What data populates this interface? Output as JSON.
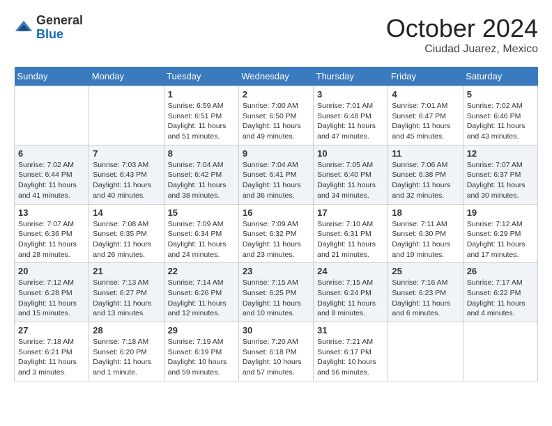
{
  "header": {
    "logo_general": "General",
    "logo_blue": "Blue",
    "month": "October 2024",
    "location": "Ciudad Juarez, Mexico"
  },
  "weekdays": [
    "Sunday",
    "Monday",
    "Tuesday",
    "Wednesday",
    "Thursday",
    "Friday",
    "Saturday"
  ],
  "weeks": [
    [
      {
        "day": "",
        "info": ""
      },
      {
        "day": "",
        "info": ""
      },
      {
        "day": "1",
        "info": "Sunrise: 6:59 AM\nSunset: 6:51 PM\nDaylight: 11 hours and 51 minutes."
      },
      {
        "day": "2",
        "info": "Sunrise: 7:00 AM\nSunset: 6:50 PM\nDaylight: 11 hours and 49 minutes."
      },
      {
        "day": "3",
        "info": "Sunrise: 7:01 AM\nSunset: 6:48 PM\nDaylight: 11 hours and 47 minutes."
      },
      {
        "day": "4",
        "info": "Sunrise: 7:01 AM\nSunset: 6:47 PM\nDaylight: 11 hours and 45 minutes."
      },
      {
        "day": "5",
        "info": "Sunrise: 7:02 AM\nSunset: 6:46 PM\nDaylight: 11 hours and 43 minutes."
      }
    ],
    [
      {
        "day": "6",
        "info": "Sunrise: 7:02 AM\nSunset: 6:44 PM\nDaylight: 11 hours and 41 minutes."
      },
      {
        "day": "7",
        "info": "Sunrise: 7:03 AM\nSunset: 6:43 PM\nDaylight: 11 hours and 40 minutes."
      },
      {
        "day": "8",
        "info": "Sunrise: 7:04 AM\nSunset: 6:42 PM\nDaylight: 11 hours and 38 minutes."
      },
      {
        "day": "9",
        "info": "Sunrise: 7:04 AM\nSunset: 6:41 PM\nDaylight: 11 hours and 36 minutes."
      },
      {
        "day": "10",
        "info": "Sunrise: 7:05 AM\nSunset: 6:40 PM\nDaylight: 11 hours and 34 minutes."
      },
      {
        "day": "11",
        "info": "Sunrise: 7:06 AM\nSunset: 6:38 PM\nDaylight: 11 hours and 32 minutes."
      },
      {
        "day": "12",
        "info": "Sunrise: 7:07 AM\nSunset: 6:37 PM\nDaylight: 11 hours and 30 minutes."
      }
    ],
    [
      {
        "day": "13",
        "info": "Sunrise: 7:07 AM\nSunset: 6:36 PM\nDaylight: 11 hours and 28 minutes."
      },
      {
        "day": "14",
        "info": "Sunrise: 7:08 AM\nSunset: 6:35 PM\nDaylight: 11 hours and 26 minutes."
      },
      {
        "day": "15",
        "info": "Sunrise: 7:09 AM\nSunset: 6:34 PM\nDaylight: 11 hours and 24 minutes."
      },
      {
        "day": "16",
        "info": "Sunrise: 7:09 AM\nSunset: 6:32 PM\nDaylight: 11 hours and 23 minutes."
      },
      {
        "day": "17",
        "info": "Sunrise: 7:10 AM\nSunset: 6:31 PM\nDaylight: 11 hours and 21 minutes."
      },
      {
        "day": "18",
        "info": "Sunrise: 7:11 AM\nSunset: 6:30 PM\nDaylight: 11 hours and 19 minutes."
      },
      {
        "day": "19",
        "info": "Sunrise: 7:12 AM\nSunset: 6:29 PM\nDaylight: 11 hours and 17 minutes."
      }
    ],
    [
      {
        "day": "20",
        "info": "Sunrise: 7:12 AM\nSunset: 6:28 PM\nDaylight: 11 hours and 15 minutes."
      },
      {
        "day": "21",
        "info": "Sunrise: 7:13 AM\nSunset: 6:27 PM\nDaylight: 11 hours and 13 minutes."
      },
      {
        "day": "22",
        "info": "Sunrise: 7:14 AM\nSunset: 6:26 PM\nDaylight: 11 hours and 12 minutes."
      },
      {
        "day": "23",
        "info": "Sunrise: 7:15 AM\nSunset: 6:25 PM\nDaylight: 11 hours and 10 minutes."
      },
      {
        "day": "24",
        "info": "Sunrise: 7:15 AM\nSunset: 6:24 PM\nDaylight: 11 hours and 8 minutes."
      },
      {
        "day": "25",
        "info": "Sunrise: 7:16 AM\nSunset: 6:23 PM\nDaylight: 11 hours and 6 minutes."
      },
      {
        "day": "26",
        "info": "Sunrise: 7:17 AM\nSunset: 6:22 PM\nDaylight: 11 hours and 4 minutes."
      }
    ],
    [
      {
        "day": "27",
        "info": "Sunrise: 7:18 AM\nSunset: 6:21 PM\nDaylight: 11 hours and 3 minutes."
      },
      {
        "day": "28",
        "info": "Sunrise: 7:18 AM\nSunset: 6:20 PM\nDaylight: 11 hours and 1 minute."
      },
      {
        "day": "29",
        "info": "Sunrise: 7:19 AM\nSunset: 6:19 PM\nDaylight: 10 hours and 59 minutes."
      },
      {
        "day": "30",
        "info": "Sunrise: 7:20 AM\nSunset: 6:18 PM\nDaylight: 10 hours and 57 minutes."
      },
      {
        "day": "31",
        "info": "Sunrise: 7:21 AM\nSunset: 6:17 PM\nDaylight: 10 hours and 56 minutes."
      },
      {
        "day": "",
        "info": ""
      },
      {
        "day": "",
        "info": ""
      }
    ]
  ]
}
